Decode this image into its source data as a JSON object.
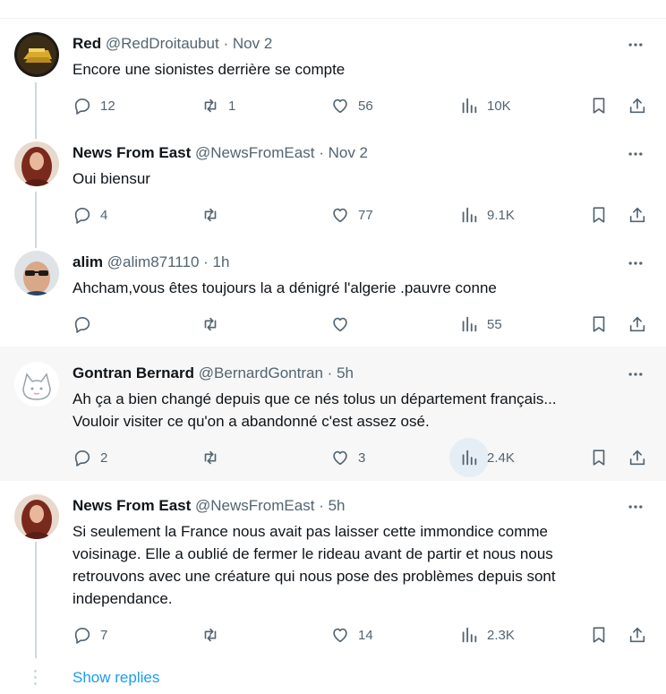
{
  "replies": [
    {
      "name": "Red",
      "handle": "@RedDroitaubut",
      "time": "Nov 2",
      "text": [
        "Encore une sionistes derrière se compte"
      ],
      "stats": {
        "replies": "12",
        "reposts": "1",
        "likes": "56",
        "views": "10K"
      },
      "avatar": "gold-bars-avatar"
    },
    {
      "name": "News From East",
      "handle": "@NewsFromEast",
      "time": "Nov 2",
      "text": [
        "Oui biensur"
      ],
      "stats": {
        "replies": "4",
        "reposts": "",
        "likes": "77",
        "views": "9.1K"
      },
      "avatar": "woman-portrait-avatar"
    },
    {
      "name": "alim",
      "handle": "@alim871110",
      "time": "1h",
      "text": [
        "Ahcham,vous êtes toujours la a dénigré  l'algerie .pauvre conne"
      ],
      "stats": {
        "replies": "",
        "reposts": "",
        "likes": "",
        "views": "55"
      },
      "avatar": "man-sunglasses-avatar"
    },
    {
      "name": "Gontran Bernard",
      "handle": "@BernardGontran",
      "time": "5h",
      "text": [
        "Ah ça a bien changé depuis que ce nés tolus un département français...",
        "Vouloir visiter ce qu'on a abandonné c'est assez osé."
      ],
      "stats": {
        "replies": "2",
        "reposts": "",
        "likes": "3",
        "views": "2.4K"
      },
      "avatar": "cat-sketch-avatar"
    },
    {
      "name": "News From East",
      "handle": "@NewsFromEast",
      "time": "5h",
      "text": [
        "Si seulement la France nous avait pas laisser cette immondice comme",
        "voisinage.  Elle a oublié de fermer le rideau avant de partir et nous nous",
        "retrouvons avec une créature qui nous pose des problèmes depuis sont",
        "independance."
      ],
      "stats": {
        "replies": "7",
        "reposts": "",
        "likes": "14",
        "views": "2.3K"
      },
      "avatar": "woman-portrait-avatar"
    }
  ],
  "separator": "·",
  "show_replies_label": "Show replies",
  "colors": {
    "text": "#0f1419",
    "secondary": "#536471",
    "link": "#1d9bf0",
    "hover_bg": "#f7f7f7",
    "thread_line": "#cfd9de"
  }
}
